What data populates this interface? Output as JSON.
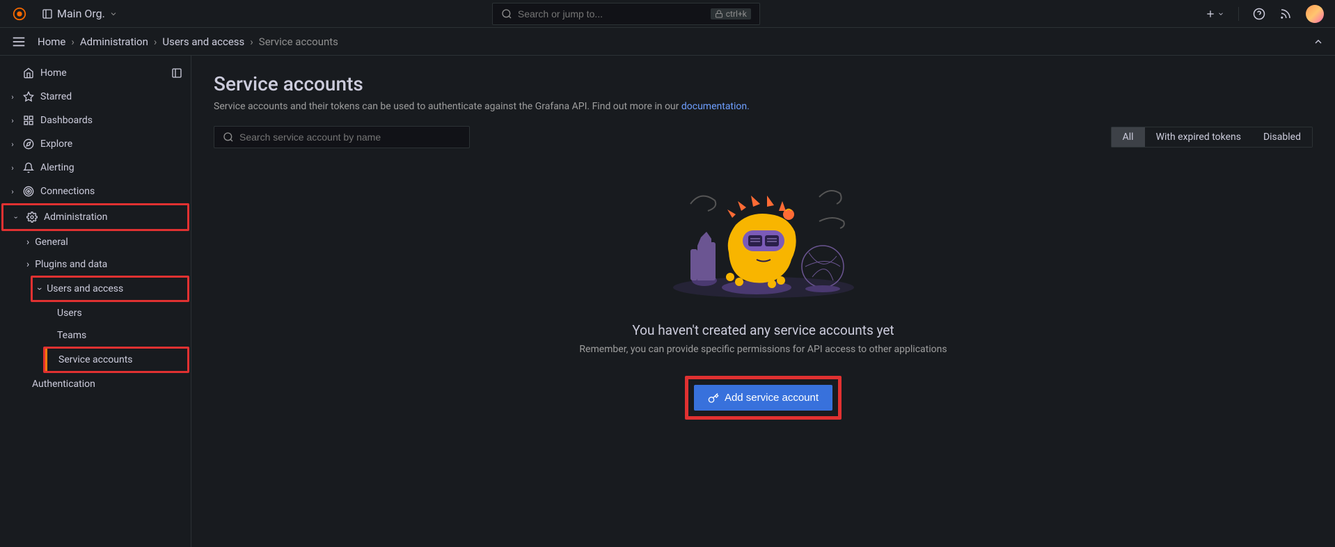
{
  "topBar": {
    "orgName": "Main Org.",
    "searchPlaceholder": "Search or jump to...",
    "searchShortcut": "ctrl+k"
  },
  "breadcrumbs": {
    "home": "Home",
    "administration": "Administration",
    "usersAccess": "Users and access",
    "serviceAccounts": "Service accounts"
  },
  "sidebar": {
    "home": "Home",
    "starred": "Starred",
    "dashboards": "Dashboards",
    "explore": "Explore",
    "alerting": "Alerting",
    "connections": "Connections",
    "administration": "Administration",
    "general": "General",
    "pluginsAndData": "Plugins and data",
    "usersAndAccess": "Users and access",
    "users": "Users",
    "teams": "Teams",
    "serviceAccounts": "Service accounts",
    "authentication": "Authentication"
  },
  "page": {
    "title": "Service accounts",
    "descriptionPrefix": "Service accounts and their tokens can be used to authenticate against the Grafana API. Find out more in our ",
    "docLinkText": "documentation.",
    "searchPlaceholder": "Search service account by name"
  },
  "filters": {
    "all": "All",
    "withExpired": "With expired tokens",
    "disabled": "Disabled"
  },
  "emptyState": {
    "title": "You haven't created any service accounts yet",
    "subtitle": "Remember, you can provide specific permissions for API access to other applications",
    "buttonLabel": "Add service account"
  }
}
